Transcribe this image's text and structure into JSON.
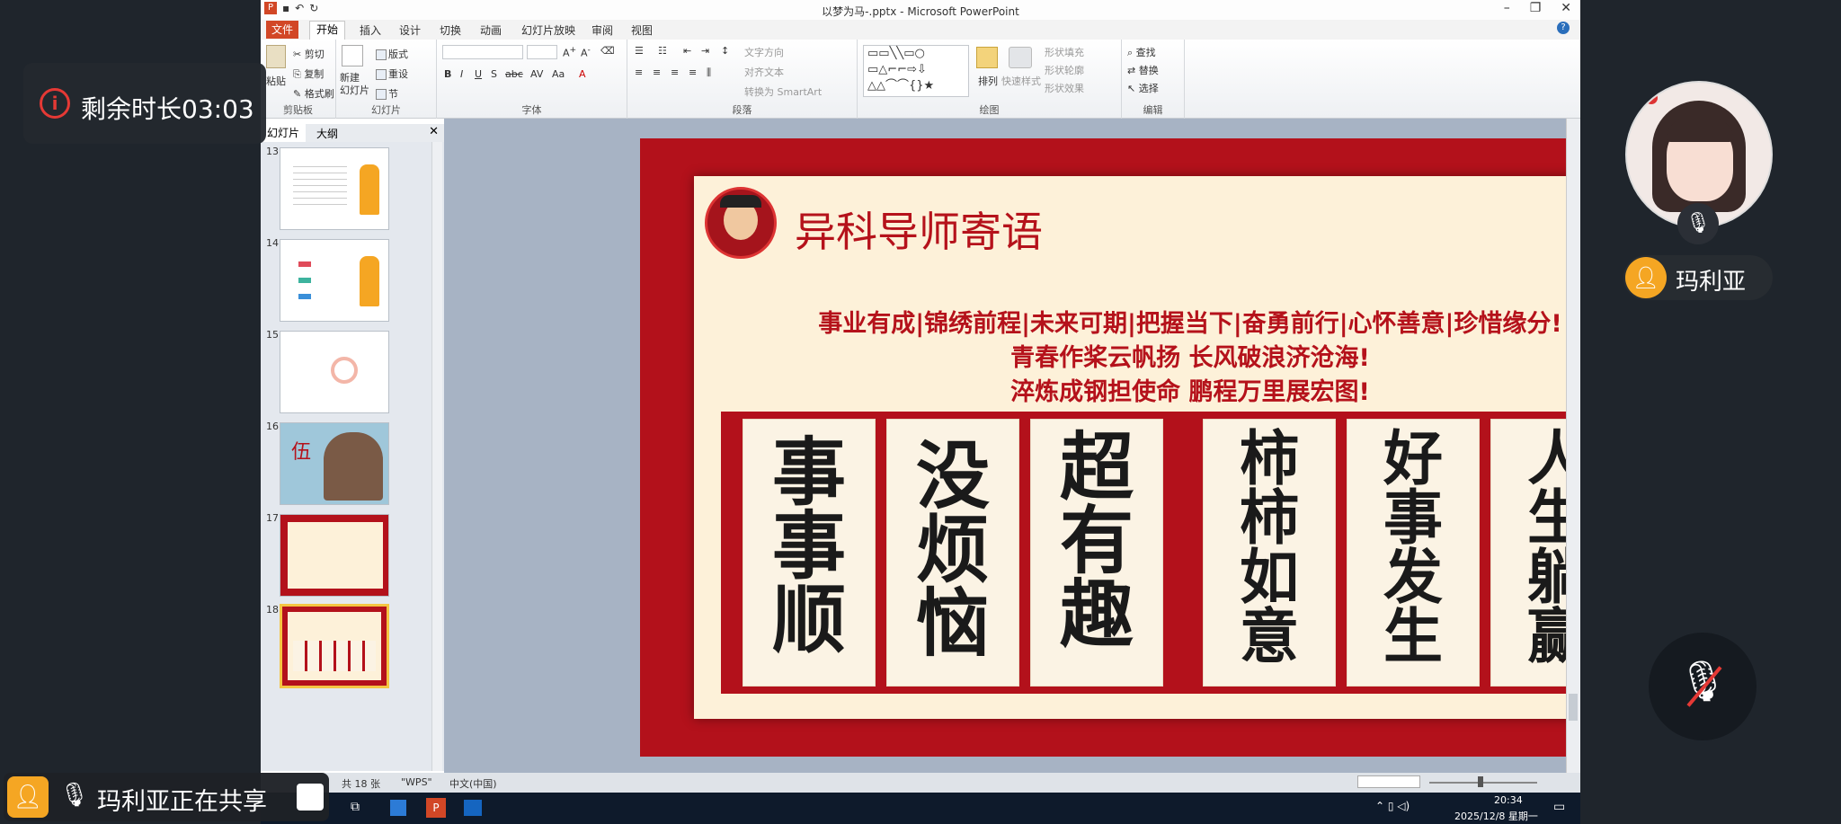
{
  "window": {
    "title": "以梦为马-.pptx - Microsoft PowerPoint"
  },
  "menu": {
    "file": "文件",
    "tabs": [
      "开始",
      "插入",
      "设计",
      "切换",
      "动画",
      "幻灯片放映",
      "审阅",
      "视图"
    ]
  },
  "ribbon": {
    "clipboard": {
      "label": "剪贴板",
      "paste": "粘贴",
      "cut": "剪切",
      "copy": "复制",
      "format_painter": "格式刷"
    },
    "slides": {
      "label": "幻灯片",
      "new_slide": "新建\n幻灯片",
      "layout": "版式",
      "reset": "重设",
      "section": "节"
    },
    "font": {
      "label": "字体"
    },
    "paragraph": {
      "label": "段落",
      "text_direction": "文字方向",
      "align_text": "对齐文本",
      "smartart": "转换为 SmartArt"
    },
    "drawing": {
      "label": "绘图",
      "arrange": "排列",
      "quick_styles": "快速样式",
      "shape_fill": "形状填充",
      "shape_outline": "形状轮廓",
      "shape_effects": "形状效果"
    },
    "editing": {
      "label": "编辑",
      "find": "查找",
      "replace": "替换",
      "select": "选择"
    }
  },
  "panel": {
    "tabs": [
      "幻灯片",
      "大纲"
    ],
    "thumbs": [
      {
        "num": "13"
      },
      {
        "num": "14"
      },
      {
        "num": "15"
      },
      {
        "num": "16",
        "text": "伍"
      },
      {
        "num": "17"
      },
      {
        "num": "18"
      }
    ]
  },
  "slide": {
    "title": "异科导师寄语",
    "line1": "事业有成|锦绣前程|未来可期|把握当下|奋勇前行|心怀善意|珍惜缘分!",
    "line2": "青春作桨云帆扬 长风破浪济沧海!",
    "line3": "淬炼成钢担使命 鹏程万里展宏图!",
    "artworks": [
      "事事顺",
      "没烦恼",
      "超有趣",
      "柿柿如意",
      "好事发生",
      "人生躺赢"
    ]
  },
  "status": {
    "count": "共 18 张",
    "theme": "\"WPS\"",
    "lang": "中文(中国)"
  },
  "taskbar": {
    "time": "20:34",
    "date": "2025/12/8 星期一"
  },
  "overlay": {
    "timer": "剩余时长03:03",
    "user": "玛利亚",
    "sharing": "玛利亚正在共享"
  },
  "colors": {
    "accent": "#b5121b",
    "file_tab": "#d24726",
    "overlay_orange": "#f5a623"
  }
}
